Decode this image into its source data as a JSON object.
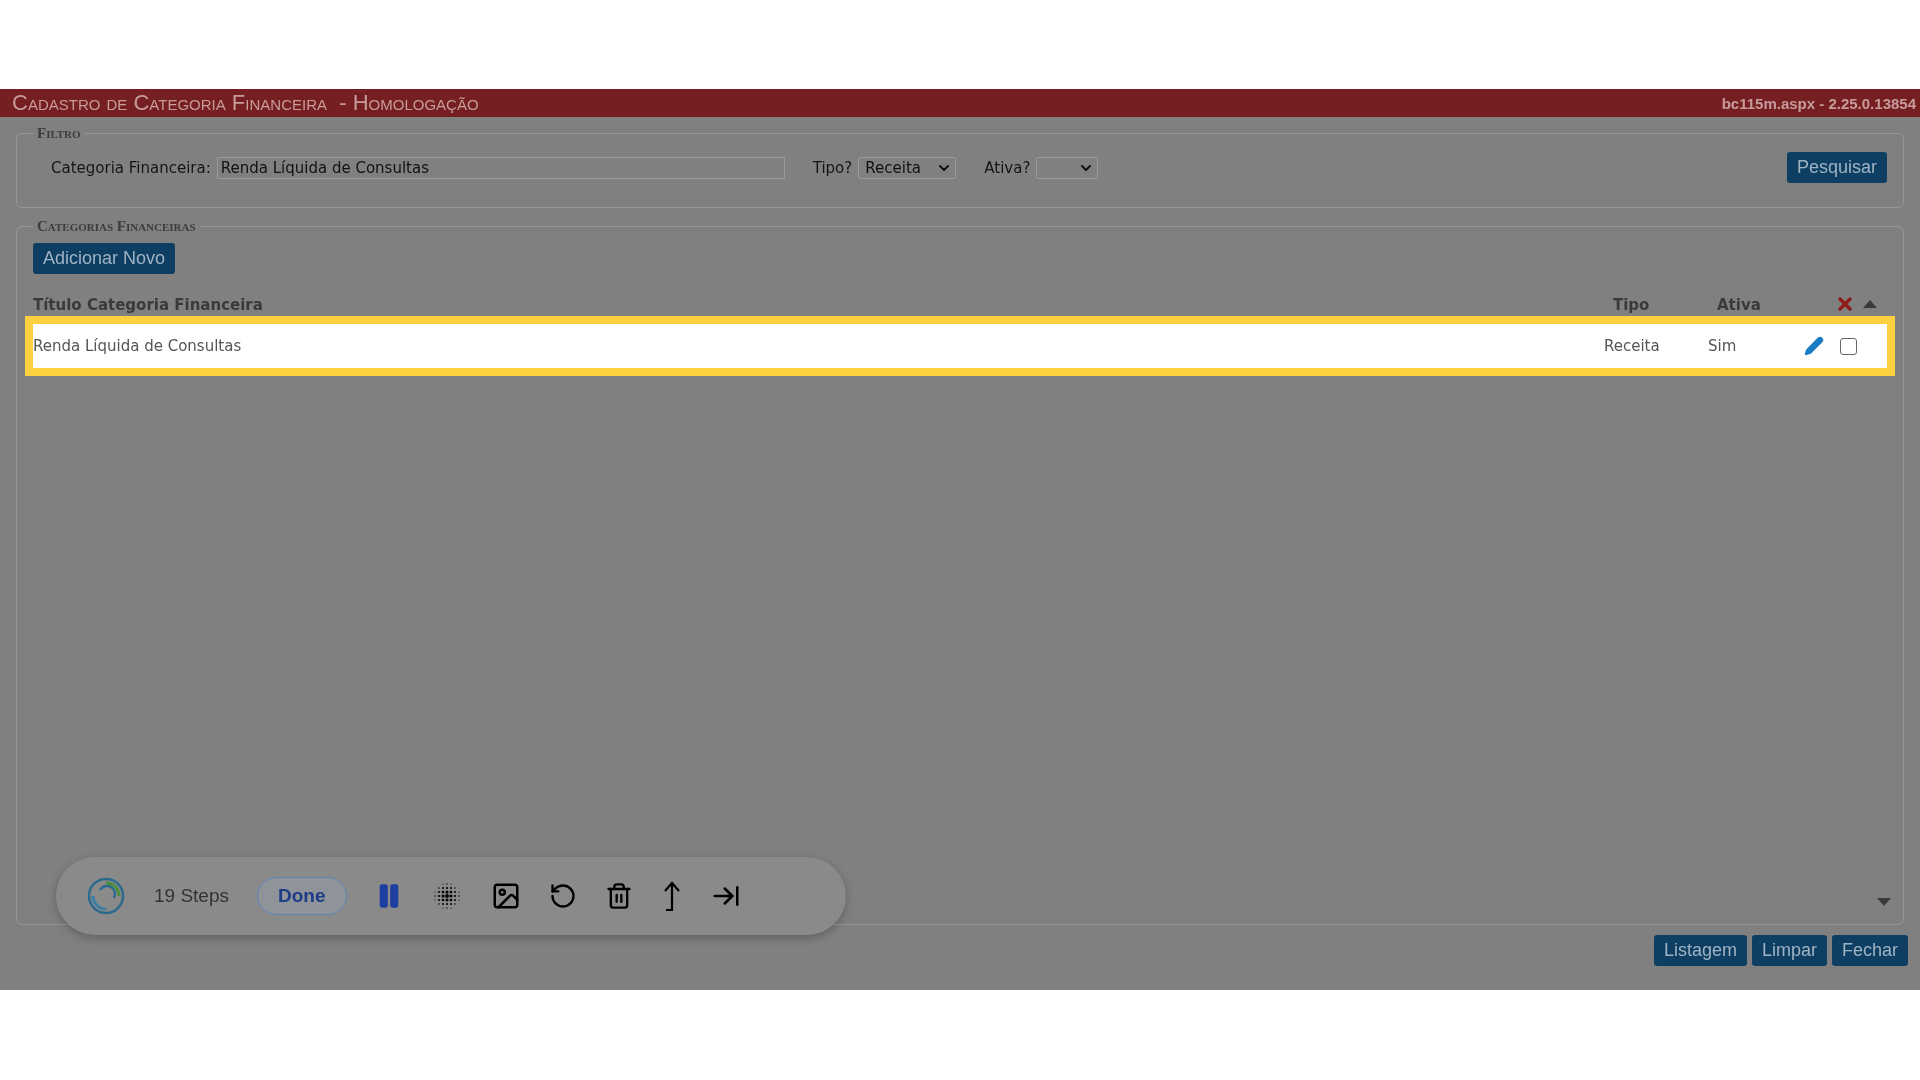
{
  "header": {
    "title": "Cadastro de Categoria Financeira",
    "environment": "- Homologação",
    "version": "bc115m.aspx - 2.25.0.13854"
  },
  "filter": {
    "legend": "Filtro",
    "category_label": "Categoria Financeira:",
    "category_value": "Renda Líquida de Consultas",
    "tipo_label": "Tipo?",
    "tipo_value": "Receita",
    "ativa_label": "Ativa?",
    "search_button": "Pesquisar"
  },
  "categories": {
    "legend": "Categorias Financeiras",
    "add_button": "Adicionar Novo",
    "columns": [
      "Título Categoria Financeira",
      "Tipo",
      "Ativa"
    ],
    "rows": [
      {
        "title": "Renda Líquida de Consultas",
        "tipo": "Receita",
        "ativa": "Sim",
        "checked": false,
        "highlighted": true
      }
    ]
  },
  "recorder": {
    "steps": "19 Steps",
    "done_button": "Done"
  },
  "footer_buttons": [
    "Listagem",
    "Limpar",
    "Fechar"
  ]
}
